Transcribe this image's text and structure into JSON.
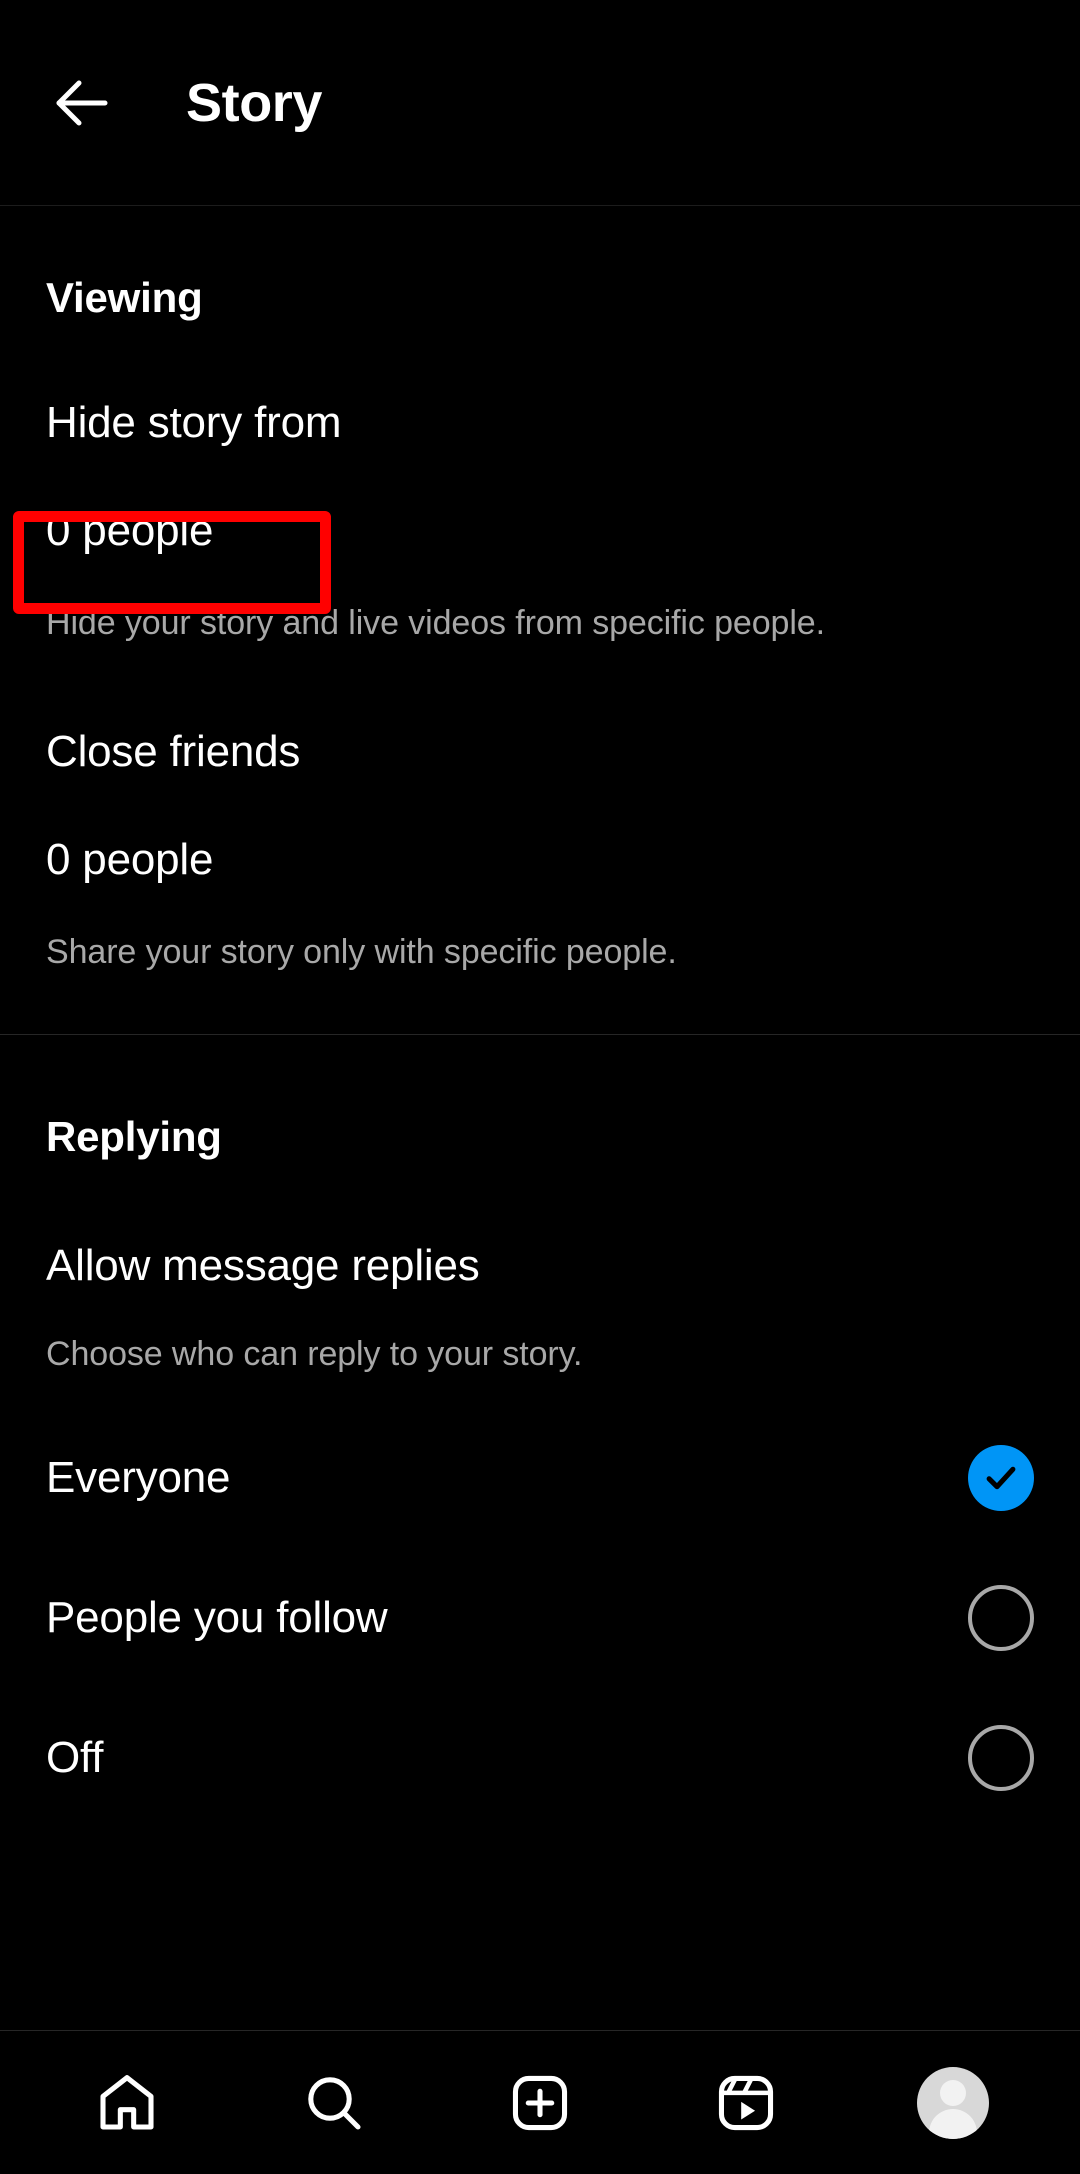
{
  "header": {
    "back_icon": "arrow-left-icon",
    "title": "Story"
  },
  "sections": [
    {
      "id": "viewing",
      "title": "Viewing",
      "items": [
        {
          "title": "Hide story from",
          "value": "0 people",
          "description": "Hide your story and live videos from specific people.",
          "highlighted": true
        },
        {
          "title": "Close friends",
          "value": "0 people",
          "description": "Share your story only with specific people.",
          "highlighted": false
        }
      ]
    },
    {
      "id": "replying",
      "title": "Replying",
      "setting_title": "Allow message replies",
      "setting_description": "Choose who can reply to your story.",
      "options": [
        {
          "label": "Everyone",
          "selected": true
        },
        {
          "label": "People you follow",
          "selected": false
        },
        {
          "label": "Off",
          "selected": false
        }
      ]
    }
  ],
  "bottom_nav": [
    {
      "name": "home-icon",
      "label": "Home"
    },
    {
      "name": "search-icon",
      "label": "Search"
    },
    {
      "name": "create-icon",
      "label": "Create"
    },
    {
      "name": "reels-icon",
      "label": "Reels"
    },
    {
      "name": "profile-avatar",
      "label": "Profile"
    }
  ],
  "colors": {
    "background": "#000000",
    "accent_blue": "#0095f6",
    "highlight_red": "#ff0000",
    "secondary_text": "#a8a8a8",
    "divider": "#262626"
  }
}
